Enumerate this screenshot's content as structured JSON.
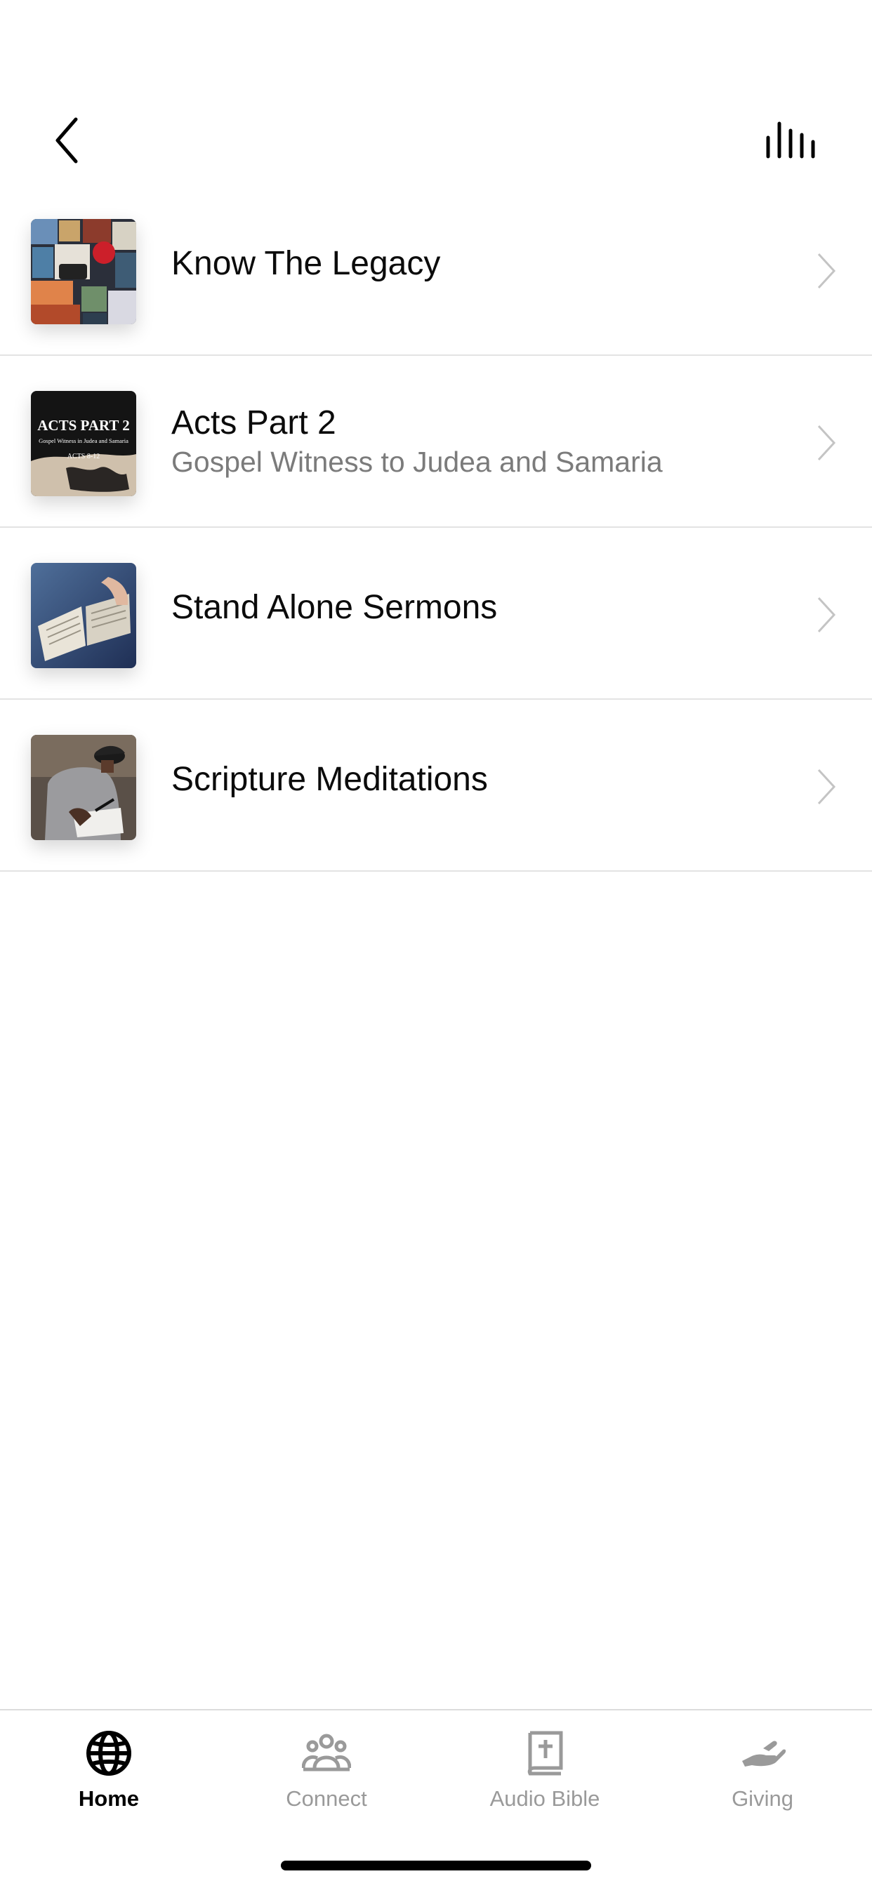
{
  "items": [
    {
      "title": "Know The Legacy",
      "subtitle": ""
    },
    {
      "title": "Acts Part 2",
      "subtitle": "Gospel Witness to Judea and Samaria",
      "art_title": "ACTS PART 2",
      "art_sub": "Gospel Witness in Judea and Samaria",
      "art_ref": "ACTS 8-12"
    },
    {
      "title": "Stand Alone Sermons",
      "subtitle": ""
    },
    {
      "title": "Scripture Meditations",
      "subtitle": ""
    }
  ],
  "tabs": [
    {
      "label": "Home",
      "icon": "globe-icon",
      "active": true
    },
    {
      "label": "Connect",
      "icon": "people-icon",
      "active": false
    },
    {
      "label": "Audio Bible",
      "icon": "bible-icon",
      "active": false
    },
    {
      "label": "Giving",
      "icon": "giving-hand-icon",
      "active": false
    }
  ],
  "colors": {
    "active": "#000000",
    "inactive": "#9a9a9a",
    "divider": "#e3e3e3"
  }
}
